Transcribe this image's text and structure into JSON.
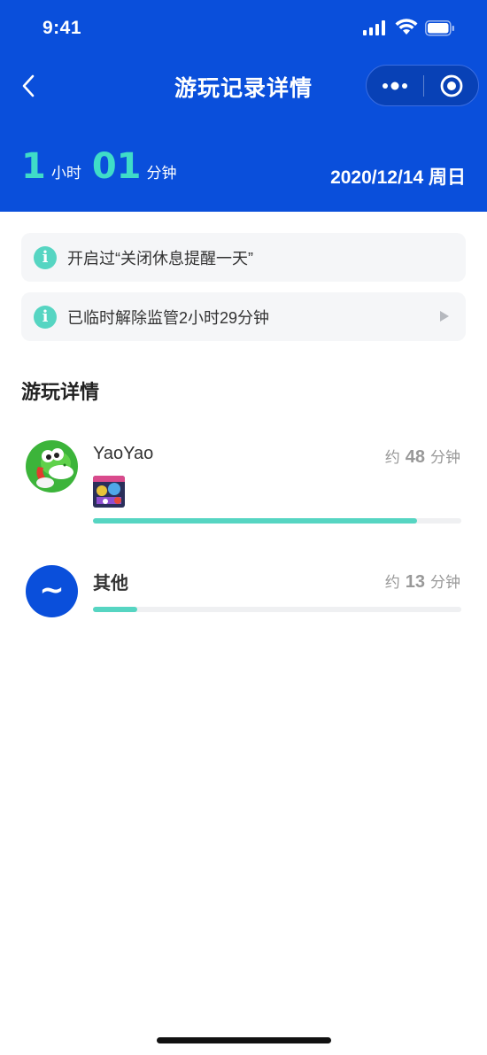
{
  "status_bar": {
    "time": "9:41"
  },
  "nav": {
    "title": "游玩记录详情"
  },
  "summary": {
    "hours": "1",
    "hours_unit": "小时",
    "minutes": "01",
    "minutes_unit": "分钟",
    "date": "2020/12/14 周日"
  },
  "notices": [
    {
      "icon": "info-icon",
      "glyph": "i",
      "text": "开启过“关闭休息提醒一天”"
    },
    {
      "icon": "info-icon",
      "glyph": "i",
      "text": "已临时解除监管2小时29分钟"
    }
  ],
  "section": {
    "title": "游玩详情"
  },
  "entries": [
    {
      "name": "YaoYao",
      "prefix": "约",
      "minutes": "48",
      "unit": "分钟",
      "progress": 0.88,
      "avatar": "yoshi-avatar"
    },
    {
      "name": "其他",
      "prefix": "约",
      "minutes": "13",
      "unit": "分钟",
      "progress": 0.12,
      "avatar": "other-avatar",
      "avatar_glyph": "~"
    }
  ],
  "colors": {
    "header": "#0a4fdb",
    "accent": "#56d5c2",
    "number": "#3fdcc8"
  }
}
